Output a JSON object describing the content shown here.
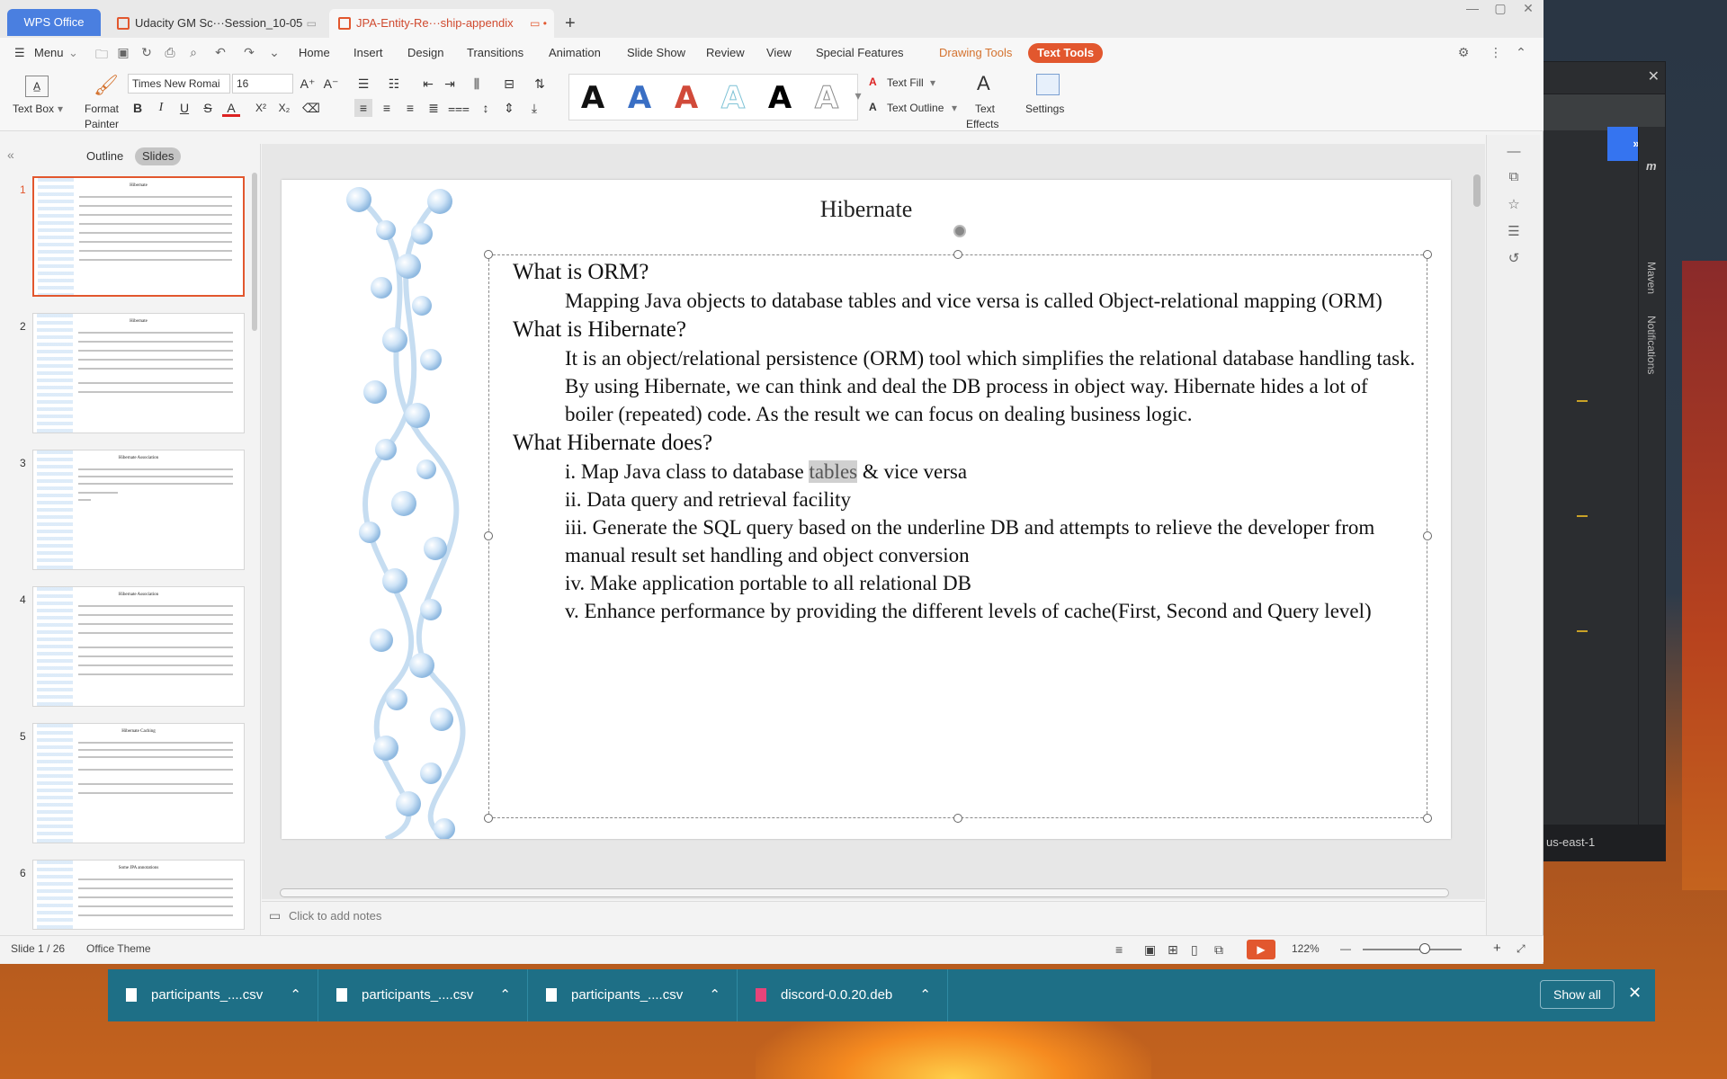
{
  "app": {
    "logo": "WPS Office",
    "tabs": [
      {
        "label": "Udacity GM Sc···Session_10-05",
        "extra": "▭"
      },
      {
        "label": "JPA-Entity-Re···ship-appendix",
        "extra": "▭  •"
      }
    ],
    "new_tab": "+",
    "window_controls": [
      "—",
      "▢",
      "✕"
    ]
  },
  "menubar": {
    "menu_label": "Menu",
    "items": [
      "Home",
      "Insert",
      "Design",
      "Transitions",
      "Animation",
      "Slide Show",
      "Review",
      "View",
      "Special Features"
    ],
    "drawing_tools": "Drawing Tools",
    "text_tools": "Text Tools"
  },
  "ribbon": {
    "text_box": "Text Box",
    "format_painter_1": "Format",
    "format_painter_2": "Painter",
    "font_name": "Times New Romai",
    "font_size": "16",
    "text_fill": "Text Fill",
    "text_outline": "Text Outline",
    "text_effects_1": "Text",
    "text_effects_2": "Effects",
    "settings": "Settings",
    "format_buttons": [
      "B",
      "I",
      "U",
      "S",
      "A",
      "X²",
      "X₂"
    ],
    "style_glyph": "A",
    "style_colors": [
      "#111111",
      "#3a6fc4",
      "#d14a3a",
      "#7fc3d6",
      "#000000",
      "#8a8a8a"
    ]
  },
  "leftpanel": {
    "outline_tab": "Outline",
    "slides_tab": "Slides",
    "thumbnails": [
      {
        "num": "1",
        "title": "Hibernate"
      },
      {
        "num": "2",
        "title": "Hibernate"
      },
      {
        "num": "3",
        "title": "Hibernate Association"
      },
      {
        "num": "4",
        "title": "Hibernate Association"
      },
      {
        "num": "5",
        "title": "Hibernate Caching"
      },
      {
        "num": "6",
        "title": "Some JPA annotations"
      }
    ]
  },
  "slide": {
    "title": "Hibernate",
    "q1": "What is ORM?",
    "a1": "Mapping Java objects to database tables and vice versa is called Object-relational mapping (ORM)",
    "q2": "What is Hibernate?",
    "a2a": "It is an object/relational persistence (ORM) tool which simplifies the relational database handling task.",
    "a2b": "By using Hibernate, we can think and deal the DB process in object way. Hibernate hides a lot of boiler (repeated) code. As the result we can focus on dealing business logic.",
    "q3": "What Hibernate does?",
    "i_pre": "i. Map Java class to database ",
    "i_hl": "tables",
    "i_post": " & vice versa",
    "ii": "ii. Data query and retrieval facility",
    "iii": "iii. Generate the SQL query based on the underline DB and attempts to relieve the developer from manual result set handling and object conversion",
    "iv": "iv. Make application portable to all relational DB",
    "v": "v. Enhance performance by providing the different levels of cache(First, Second and Query level)"
  },
  "notes": {
    "placeholder": "Click to add notes"
  },
  "status": {
    "slide_count": "Slide 1 / 26",
    "theme": "Office Theme",
    "zoom": "122%",
    "zoom_minus": "—",
    "zoom_plus": "+"
  },
  "ide": {
    "maven": "Maven",
    "notifications": "Notifications",
    "region": "us-east-1",
    "m_icon": "m"
  },
  "downloads": {
    "items": [
      {
        "name": "participants_....csv"
      },
      {
        "name": "participants_....csv"
      },
      {
        "name": "participants_....csv"
      },
      {
        "name": "discord-0.0.20.deb"
      }
    ],
    "show_all": "Show all",
    "close": "✕"
  }
}
